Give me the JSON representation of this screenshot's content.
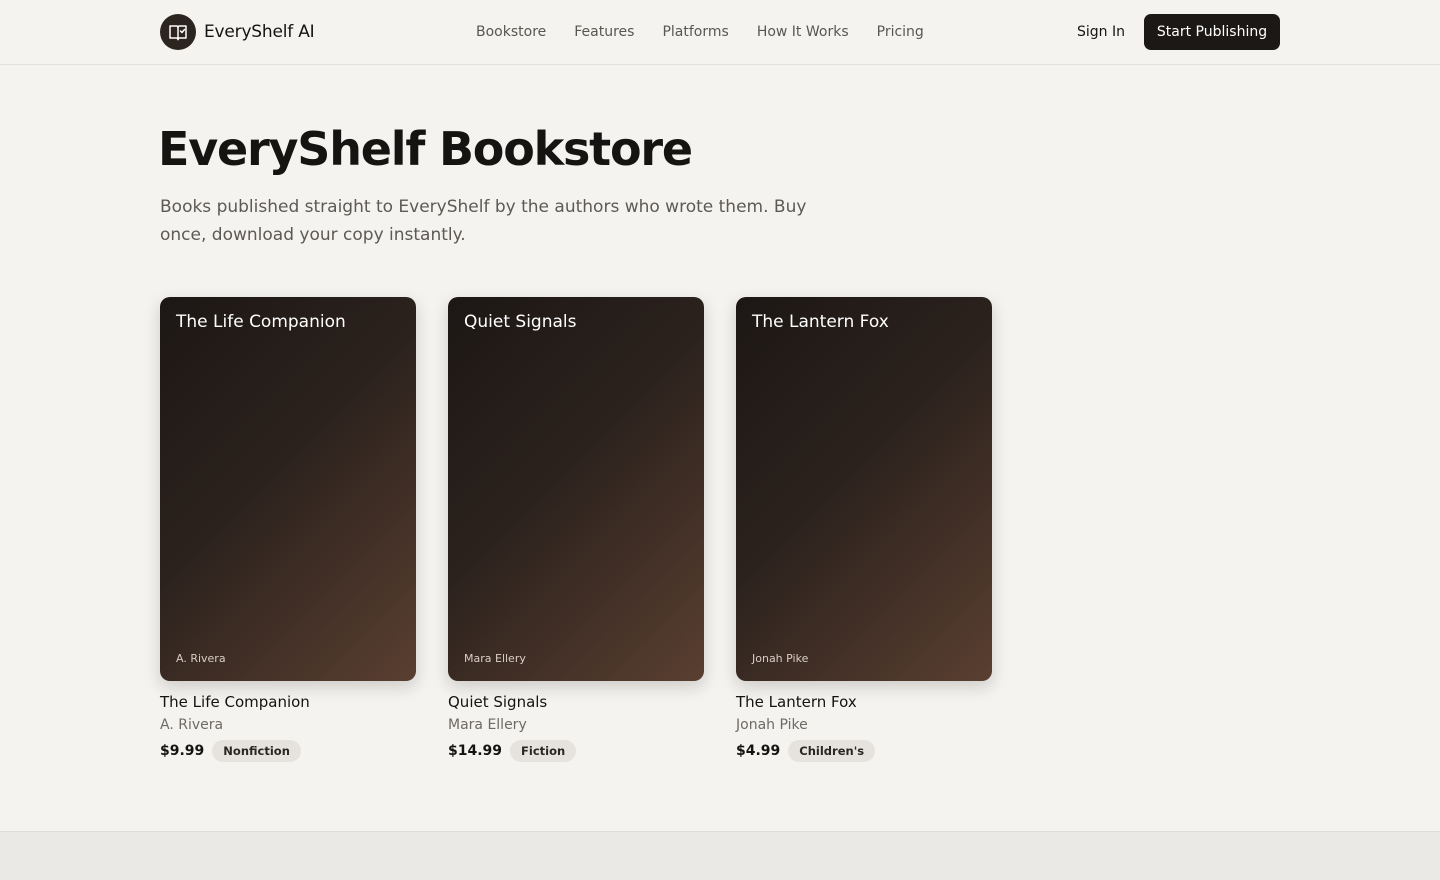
{
  "header": {
    "brand_name": "EveryShelf AI",
    "logo_icon": "open-book-check-icon",
    "nav": [
      {
        "label": "Bookstore"
      },
      {
        "label": "Features"
      },
      {
        "label": "Platforms"
      },
      {
        "label": "How It Works"
      },
      {
        "label": "Pricing"
      }
    ],
    "sign_in_label": "Sign In",
    "cta_label": "Start Publishing"
  },
  "hero": {
    "title": "EveryShelf Bookstore",
    "subtitle": "Books published straight to EveryShelf by the authors who wrote them. Buy once, download your copy instantly."
  },
  "books": [
    {
      "title": "The Life Companion",
      "author": "A. Rivera",
      "price": "$9.99",
      "category": "Nonfiction"
    },
    {
      "title": "Quiet Signals",
      "author": "Mara Ellery",
      "price": "$14.99",
      "category": "Fiction"
    },
    {
      "title": "The Lantern Fox",
      "author": "Jonah Pike",
      "price": "$4.99",
      "category": "Children's"
    }
  ],
  "colors": {
    "background": "#f4f3f0",
    "primary_button": "#1b1816",
    "cover_gradient_start": "#1c1715",
    "cover_gradient_end": "#5a3f31",
    "tag_background": "#e6e3de"
  }
}
